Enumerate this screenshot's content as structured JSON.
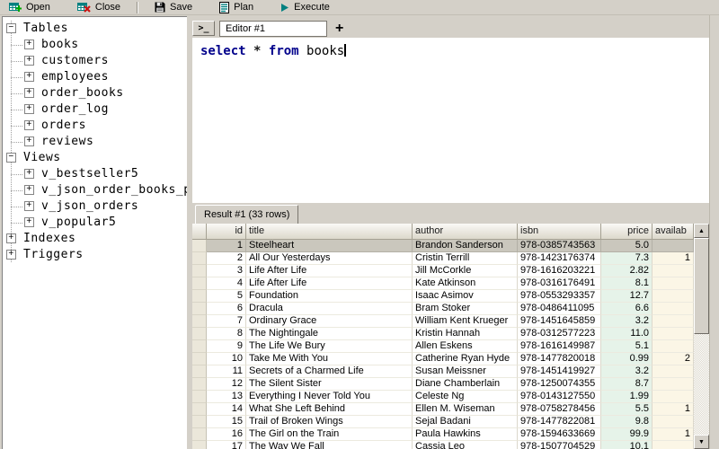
{
  "toolbar": {
    "buttons": [
      {
        "label": "Open",
        "icon": "table-add-icon"
      },
      {
        "label": "Close",
        "icon": "table-close-icon"
      },
      {
        "label": "Save",
        "icon": "floppy-disk-icon"
      },
      {
        "label": "Plan",
        "icon": "document-plan-icon"
      },
      {
        "label": "Execute",
        "icon": "play-icon"
      }
    ]
  },
  "sidebar": {
    "items": [
      {
        "label": "Tables",
        "level": 0,
        "toggle": "minus"
      },
      {
        "label": "books",
        "level": 1,
        "toggle": "plus"
      },
      {
        "label": "customers",
        "level": 1,
        "toggle": "plus"
      },
      {
        "label": "employees",
        "level": 1,
        "toggle": "plus"
      },
      {
        "label": "order_books",
        "level": 1,
        "toggle": "plus"
      },
      {
        "label": "order_log",
        "level": 1,
        "toggle": "plus"
      },
      {
        "label": "orders",
        "level": 1,
        "toggle": "plus"
      },
      {
        "label": "reviews",
        "level": 1,
        "toggle": "plus"
      },
      {
        "label": "Views",
        "level": 0,
        "toggle": "minus"
      },
      {
        "label": "v_bestseller5",
        "level": 1,
        "toggle": "plus"
      },
      {
        "label": "v_json_order_books_p",
        "level": 1,
        "toggle": "plus"
      },
      {
        "label": "v_json_orders",
        "level": 1,
        "toggle": "plus"
      },
      {
        "label": "v_popular5",
        "level": 1,
        "toggle": "plus"
      },
      {
        "label": "Indexes",
        "level": 0,
        "toggle": "plus"
      },
      {
        "label": "Triggers",
        "level": 0,
        "toggle": "plus"
      }
    ]
  },
  "editor": {
    "terminal_button": ">_",
    "tab_label": "Editor #1",
    "add_tab_label": "+",
    "sql_tokens": [
      {
        "text": "select",
        "type": "keyword"
      },
      {
        "text": " ",
        "type": "plain"
      },
      {
        "text": "*",
        "type": "operator"
      },
      {
        "text": " ",
        "type": "plain"
      },
      {
        "text": "from",
        "type": "keyword"
      },
      {
        "text": " ",
        "type": "plain"
      },
      {
        "text": "books",
        "type": "plain"
      }
    ]
  },
  "result": {
    "tab_label": "Result #1 (33 rows)",
    "columns": [
      "id",
      "title",
      "author",
      "isbn",
      "price",
      "availab"
    ],
    "selected_row": "1",
    "rows": [
      {
        "id": "1",
        "title": "Steelheart",
        "author": "Brandon Sanderson",
        "isbn": "978-0385743563",
        "price": "5.0",
        "available": ""
      },
      {
        "id": "2",
        "title": "All Our Yesterdays",
        "author": "Cristin Terrill",
        "isbn": "978-1423176374",
        "price": "7.3",
        "available": "1"
      },
      {
        "id": "3",
        "title": "Life After Life",
        "author": "Jill McCorkle",
        "isbn": "978-1616203221",
        "price": "2.82",
        "available": ""
      },
      {
        "id": "4",
        "title": "Life After Life",
        "author": "Kate Atkinson",
        "isbn": "978-0316176491",
        "price": "8.1",
        "available": ""
      },
      {
        "id": "5",
        "title": "Foundation",
        "author": "Isaac Asimov",
        "isbn": "978-0553293357",
        "price": "12.7",
        "available": ""
      },
      {
        "id": "6",
        "title": "Dracula",
        "author": "Bram Stoker",
        "isbn": "978-0486411095",
        "price": "6.6",
        "available": ""
      },
      {
        "id": "7",
        "title": "Ordinary Grace",
        "author": "William Kent Krueger",
        "isbn": "978-1451645859",
        "price": "3.2",
        "available": ""
      },
      {
        "id": "8",
        "title": "The Nightingale",
        "author": "Kristin Hannah",
        "isbn": "978-0312577223",
        "price": "11.0",
        "available": ""
      },
      {
        "id": "9",
        "title": "The Life We Bury",
        "author": "Allen Eskens",
        "isbn": "978-1616149987",
        "price": "5.1",
        "available": ""
      },
      {
        "id": "10",
        "title": "Take Me With You",
        "author": "Catherine Ryan Hyde",
        "isbn": "978-1477820018",
        "price": "0.99",
        "available": "2"
      },
      {
        "id": "11",
        "title": "Secrets of a Charmed Life",
        "author": "Susan Meissner",
        "isbn": "978-1451419927",
        "price": "3.2",
        "available": ""
      },
      {
        "id": "12",
        "title": "The Silent Sister",
        "author": "Diane Chamberlain",
        "isbn": "978-1250074355",
        "price": "8.7",
        "available": ""
      },
      {
        "id": "13",
        "title": "Everything I Never Told You",
        "author": "Celeste Ng",
        "isbn": "978-0143127550",
        "price": "1.99",
        "available": ""
      },
      {
        "id": "14",
        "title": "What She Left Behind",
        "author": "Ellen M. Wiseman",
        "isbn": "978-0758278456",
        "price": "5.5",
        "available": "1"
      },
      {
        "id": "15",
        "title": "Trail of Broken Wings",
        "author": "Sejal Badani",
        "isbn": "978-1477822081",
        "price": "9.8",
        "available": ""
      },
      {
        "id": "16",
        "title": "The Girl on the Train",
        "author": "Paula Hawkins",
        "isbn": "978-1594633669",
        "price": "99.9",
        "available": "1"
      },
      {
        "id": "17",
        "title": "The Way We Fall",
        "author": "Cassia Leo",
        "isbn": "978-1507704529",
        "price": "10.1",
        "available": ""
      }
    ]
  },
  "colors": {
    "keyword": "#00008b",
    "icon_teal": "#008080",
    "selected_row_bg": "#cac7bd",
    "price_column_bg": "#e6f3e9",
    "available_column_bg": "#fbf6e6",
    "window_bg": "#d4d0c8"
  }
}
